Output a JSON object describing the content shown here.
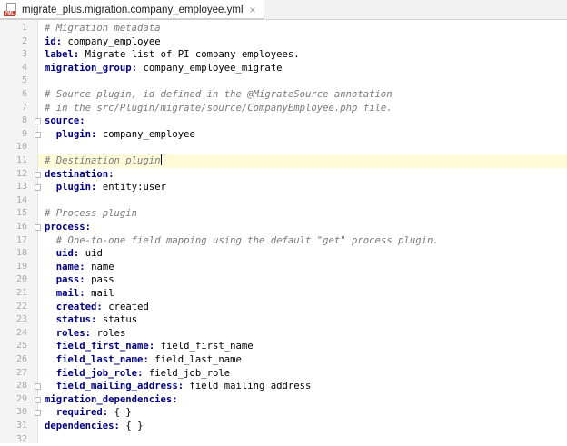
{
  "tab": {
    "filename": "migrate_plus.migration.company_employee.yml",
    "icon": "yml-file-icon",
    "icon_label": "YML",
    "close_glyph": "×"
  },
  "editor": {
    "current_line": 11,
    "lines": [
      {
        "num": "1",
        "indent": "",
        "comment": "# Migration metadata"
      },
      {
        "num": "2",
        "indent": "",
        "key": "id",
        "value": "company_employee"
      },
      {
        "num": "3",
        "indent": "",
        "key": "label",
        "value": "Migrate list of PI company employees."
      },
      {
        "num": "4",
        "indent": "",
        "key": "migration_group",
        "value": "company_employee_migrate"
      },
      {
        "num": "5",
        "indent": ""
      },
      {
        "num": "6",
        "indent": "",
        "comment": "# Source plugin, id defined in the @MigrateSource annotation"
      },
      {
        "num": "7",
        "indent": "",
        "comment": "# in the src/Plugin/migrate/source/CompanyEmployee.php file."
      },
      {
        "num": "8",
        "indent": "",
        "key": "source",
        "value": ""
      },
      {
        "num": "9",
        "indent": "  ",
        "key": "plugin",
        "value": "company_employee"
      },
      {
        "num": "10",
        "indent": ""
      },
      {
        "num": "11",
        "indent": "",
        "comment": "# Destination plugin",
        "caret": true
      },
      {
        "num": "12",
        "indent": "",
        "key": "destination",
        "value": ""
      },
      {
        "num": "13",
        "indent": "  ",
        "key": "plugin",
        "value": "entity:user"
      },
      {
        "num": "14",
        "indent": ""
      },
      {
        "num": "15",
        "indent": "",
        "comment": "# Process plugin"
      },
      {
        "num": "16",
        "indent": "",
        "key": "process",
        "value": ""
      },
      {
        "num": "17",
        "indent": "  ",
        "comment": "# One-to-one field mapping using the default \"get\" process plugin."
      },
      {
        "num": "18",
        "indent": "  ",
        "key": "uid",
        "value": "uid"
      },
      {
        "num": "19",
        "indent": "  ",
        "key": "name",
        "value": "name"
      },
      {
        "num": "20",
        "indent": "  ",
        "key": "pass",
        "value": "pass"
      },
      {
        "num": "21",
        "indent": "  ",
        "key": "mail",
        "value": "mail"
      },
      {
        "num": "22",
        "indent": "  ",
        "key": "created",
        "value": "created"
      },
      {
        "num": "23",
        "indent": "  ",
        "key": "status",
        "value": "status"
      },
      {
        "num": "24",
        "indent": "  ",
        "key": "roles",
        "value": "roles"
      },
      {
        "num": "25",
        "indent": "  ",
        "key": "field_first_name",
        "value": "field_first_name"
      },
      {
        "num": "26",
        "indent": "  ",
        "key": "field_last_name",
        "value": "field_last_name"
      },
      {
        "num": "27",
        "indent": "  ",
        "key": "field_job_role",
        "value": "field_job_role"
      },
      {
        "num": "28",
        "indent": "  ",
        "key": "field_mailing_address",
        "value": "field_mailing_address"
      },
      {
        "num": "29",
        "indent": "",
        "key": "migration_dependencies",
        "value": ""
      },
      {
        "num": "30",
        "indent": "  ",
        "key": "required",
        "value": "{ }"
      },
      {
        "num": "31",
        "indent": "",
        "key": "dependencies",
        "value": "{ }"
      },
      {
        "num": "32",
        "indent": ""
      }
    ],
    "fold_markers": [
      "8",
      "9",
      "12",
      "13",
      "16",
      "28",
      "29",
      "30"
    ]
  }
}
